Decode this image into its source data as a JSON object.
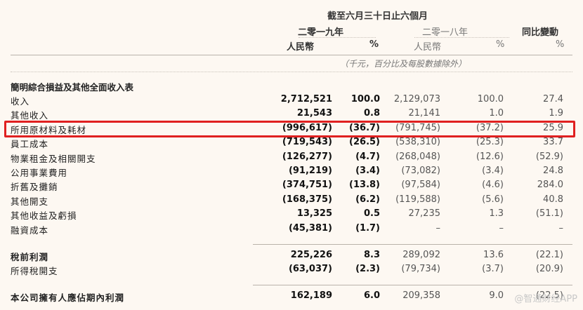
{
  "header": {
    "period": "截至六月三十日止六個月",
    "year_2019": "二零一九年",
    "year_2018": "二零一八年",
    "yoy": "同比變動",
    "rmb_2019": "人民幣",
    "pct_2019": "%",
    "rmb_2018": "人民幣",
    "pct_2018": "%",
    "pct_yoy": "%",
    "unit_note": "（千元，百分比及每股數據除外）"
  },
  "section_title": "簡明綜合損益及其他全面收入表",
  "rows": [
    {
      "label": "收入",
      "v2019": "2,712,521",
      "p2019": "100.0",
      "v2018": "2,129,073",
      "p2018": "100.0",
      "yoy": "27.4"
    },
    {
      "label": "其他收入",
      "v2019": "21,543",
      "p2019": "0.8",
      "v2018": "21,141",
      "p2018": "1.0",
      "yoy": "1.9"
    },
    {
      "label": "所用原材料及耗材",
      "v2019": "(996,617)",
      "p2019": "(36.7)",
      "v2018": "(791,745)",
      "p2018": "(37.2)",
      "yoy": "25.9"
    },
    {
      "label": "員工成本",
      "v2019": "(719,543)",
      "p2019": "(26.5)",
      "v2018": "(538,310)",
      "p2018": "(25.3)",
      "yoy": "33.7"
    },
    {
      "label": "物業租金及相關開支",
      "v2019": "(126,277)",
      "p2019": "(4.7)",
      "v2018": "(268,048)",
      "p2018": "(12.6)",
      "yoy": "(52.9)"
    },
    {
      "label": "公用事業費用",
      "v2019": "(91,219)",
      "p2019": "(3.4)",
      "v2018": "(73,082)",
      "p2018": "(3.4)",
      "yoy": "24.8"
    },
    {
      "label": "折舊及攤銷",
      "v2019": "(374,751)",
      "p2019": "(13.8)",
      "v2018": "(97,584)",
      "p2018": "(4.6)",
      "yoy": "284.0"
    },
    {
      "label": "其他開支",
      "v2019": "(168,375)",
      "p2019": "(6.2)",
      "v2018": "(119,588)",
      "p2018": "(5.6)",
      "yoy": "40.8"
    },
    {
      "label": "其他收益及虧損",
      "v2019": "13,325",
      "p2019": "0.5",
      "v2018": "27,235",
      "p2018": "1.3",
      "yoy": "(51.1)"
    },
    {
      "label": "融資成本",
      "v2019": "(45,381)",
      "p2019": "(1.7)",
      "v2018": "–",
      "p2018": "–",
      "yoy": "–"
    }
  ],
  "subtotal_rows": [
    {
      "label": "稅前利潤",
      "v2019": "225,226",
      "p2019": "8.3",
      "v2018": "289,092",
      "p2018": "13.6",
      "yoy": "(22.1)"
    },
    {
      "label": "所得稅開支",
      "v2019": "(63,037)",
      "p2019": "(2.3)",
      "v2018": "(79,734)",
      "p2018": "(3.7)",
      "yoy": "(20.9)"
    }
  ],
  "total_row": {
    "label": "本公司擁有人應佔期內利潤",
    "v2019": "162,189",
    "p2019": "6.0",
    "v2018": "209,358",
    "p2018": "9.0",
    "yoy": "(22.5)"
  },
  "watermark": "@智通财经APP",
  "colors": {
    "highlight": "#e02020",
    "background": "#fdf8f2"
  }
}
